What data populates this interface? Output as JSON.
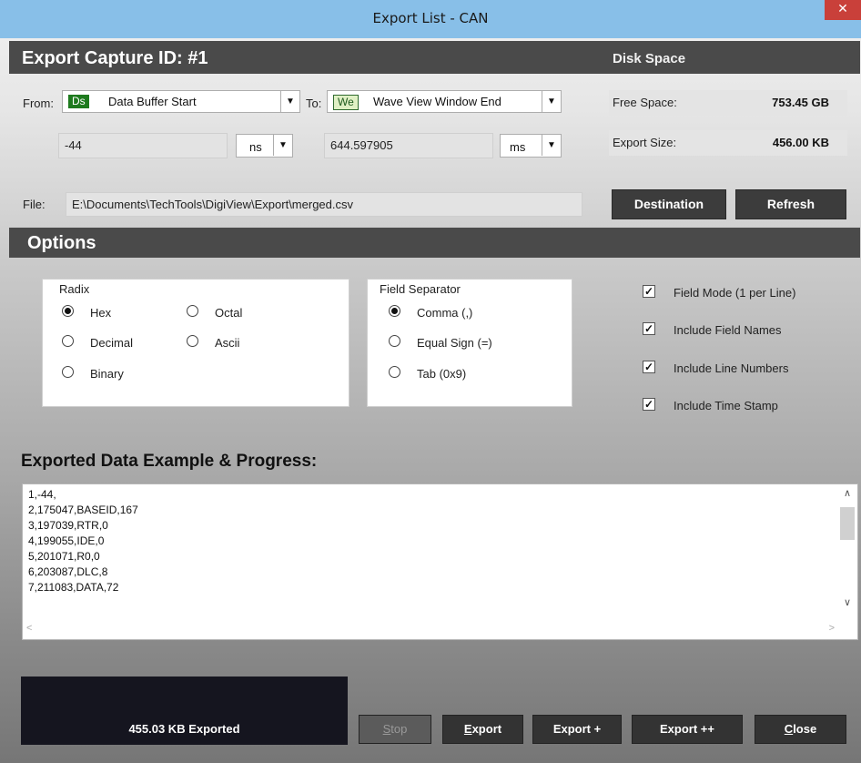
{
  "window": {
    "title": "Export List - CAN",
    "close_glyph": "✕"
  },
  "capture": {
    "heading": "Export Capture ID: #1",
    "disk_heading": "Disk Space"
  },
  "from": {
    "label": "From:",
    "code": "Ds",
    "value": "Data Buffer Start",
    "offset": "-44",
    "unit": "ns"
  },
  "to": {
    "label": "To:",
    "code": "We",
    "value": "Wave View Window End",
    "offset": "644.597905",
    "unit": "ms"
  },
  "disk": {
    "free_label": "Free Space:",
    "free_value": "753.45 GB",
    "export_label": "Export Size:",
    "export_value": "456.00 KB"
  },
  "file": {
    "label": "File:",
    "path": "E:\\Documents\\TechTools\\DigiView\\Export\\merged.csv"
  },
  "buttons_top": {
    "destination": "Destination",
    "refresh": "Refresh"
  },
  "options": {
    "heading": "Options",
    "radix": {
      "title": "Radix",
      "hex": "Hex",
      "octal": "Octal",
      "decimal": "Decimal",
      "ascii": "Ascii",
      "binary": "Binary",
      "selected": "Hex"
    },
    "separator": {
      "title": "Field Separator",
      "comma": "Comma (,)",
      "equal": "Equal Sign (=)",
      "tab": "Tab (0x9)",
      "selected": "Comma (,)"
    },
    "checks": {
      "field_mode": "Field Mode (1 per Line)",
      "field_names": "Include Field Names",
      "line_numbers": "Include Line Numbers",
      "time_stamp": "Include Time Stamp"
    }
  },
  "example": {
    "heading": "Exported Data Example & Progress:",
    "lines": [
      "1,-44,",
      "2,175047,BASEID,167",
      "3,197039,RTR,0",
      "4,199055,IDE,0",
      "5,201071,R0,0",
      "6,203087,DLC,8",
      "7,211083,DATA,72"
    ]
  },
  "progress": {
    "text": "455.03 KB Exported"
  },
  "buttons_bottom": {
    "stop_first": "S",
    "stop_rest": "top",
    "export_first": "E",
    "export_rest": "xport",
    "export_plus": "Export +",
    "export_plusplus": "Export ++",
    "close_first": "C",
    "close_rest": "lose"
  }
}
